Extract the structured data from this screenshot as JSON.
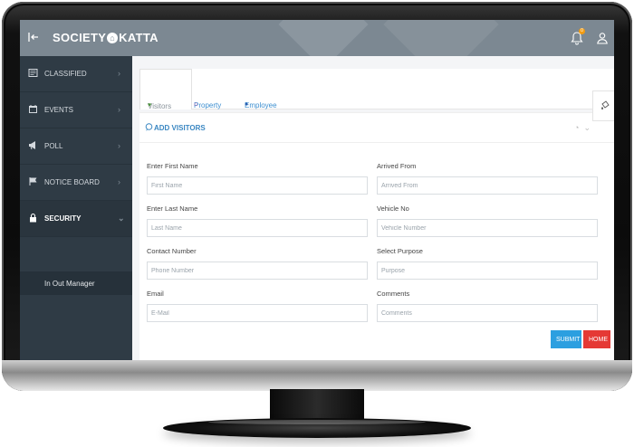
{
  "app": {
    "brand_left": "SOCIETY",
    "brand_right": "KATTA",
    "notification_count": "0"
  },
  "sidebar": {
    "items": [
      {
        "label": "CLASSIFIED",
        "icon": "newspaper-icon"
      },
      {
        "label": "EVENTS",
        "icon": "calendar-icon"
      },
      {
        "label": "POLL",
        "icon": "megaphone-icon"
      },
      {
        "label": "NOTICE BOARD",
        "icon": "flag-icon"
      },
      {
        "label": "SECURITY",
        "icon": "lock-icon"
      }
    ],
    "sub_item": "In Out Manager"
  },
  "tabs": [
    {
      "label": "Visitors"
    },
    {
      "label": "Property"
    },
    {
      "label": "Employee"
    }
  ],
  "panel": {
    "title": "ADD VISITORS"
  },
  "form": {
    "first_name": {
      "label": "Enter First Name",
      "placeholder": "First Name"
    },
    "arrived_from": {
      "label": "Arrived From",
      "placeholder": "Arrived From"
    },
    "last_name": {
      "label": "Enter Last Name",
      "placeholder": "Last Name"
    },
    "vehicle_no": {
      "label": "Vehicle No",
      "placeholder": "Vehicle Number"
    },
    "contact": {
      "label": "Contact Number",
      "placeholder": "Phone Number"
    },
    "purpose": {
      "label": "Select Purpose",
      "placeholder": "Purpose"
    },
    "email": {
      "label": "Email",
      "placeholder": "E-Mail"
    },
    "comments": {
      "label": "Comments",
      "placeholder": "Comments"
    }
  },
  "buttons": {
    "submit": "SUBMIT",
    "home": "HOME"
  },
  "colors": {
    "topbar": "#7c8892",
    "sidebar": "#2f3b45",
    "accent": "#3a87c2",
    "submit": "#2c9fe0",
    "home": "#e53935"
  }
}
